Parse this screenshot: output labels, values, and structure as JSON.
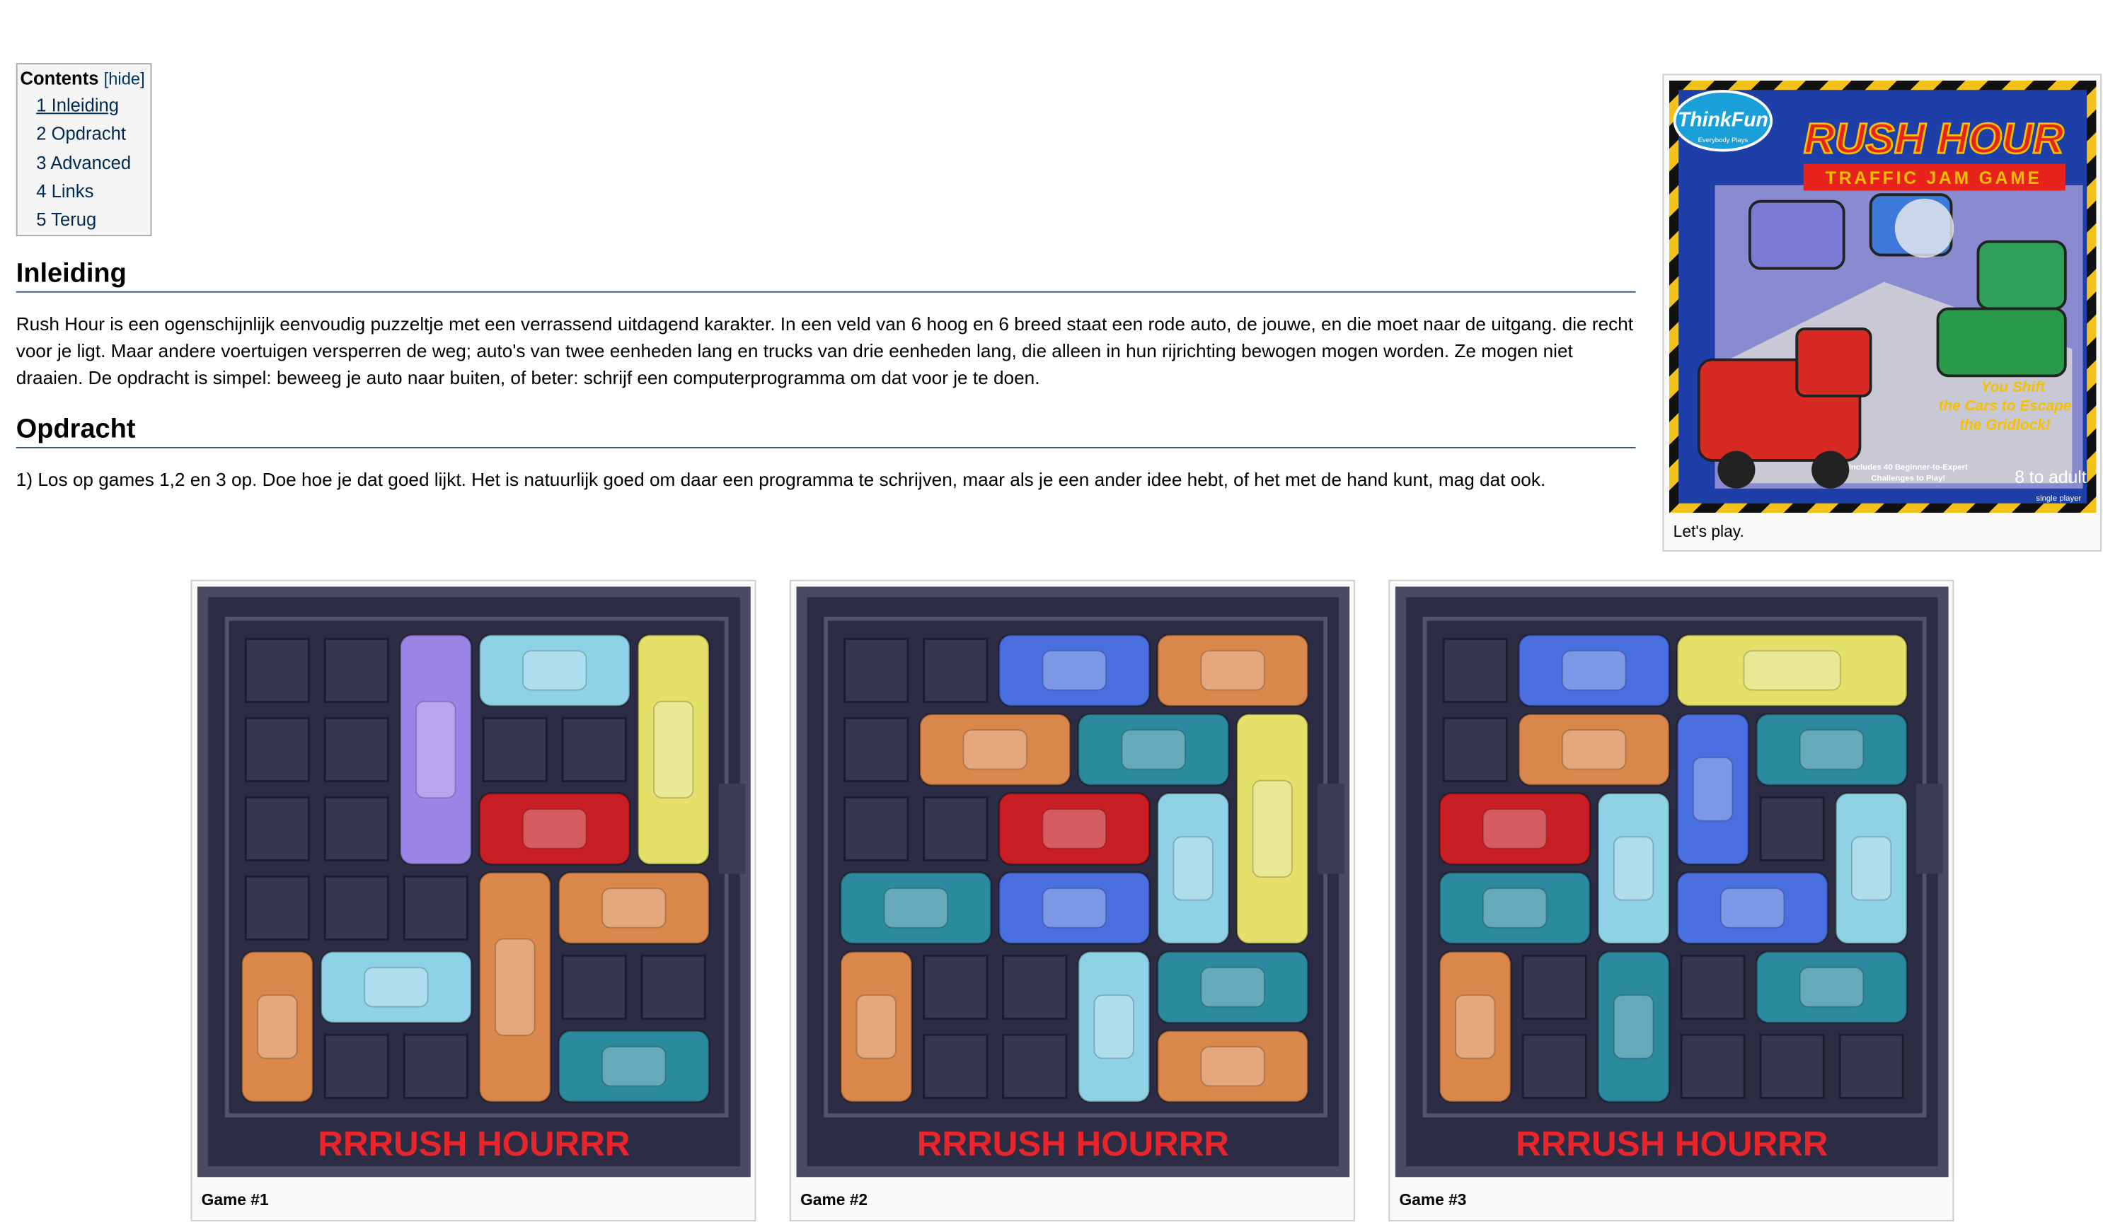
{
  "toc": {
    "title": "Contents",
    "hide": "[hide]",
    "items": [
      "1 Inleiding",
      "2 Opdracht",
      "3 Advanced",
      "4 Links",
      "5 Terug"
    ]
  },
  "sections": {
    "inleiding": {
      "heading": "Inleiding",
      "text": "Rush Hour is een ogenschijnlijk eenvoudig puzzeltje met een verrassend uitdagend karakter. In een veld van 6 hoog en 6 breed staat een rode auto, de jouwe, en die moet naar de uitgang. die recht voor je ligt. Maar andere voertuigen versperren de weg; auto's van twee eenheden lang en trucks van drie eenheden lang, die alleen in hun rijrichting bewogen mogen worden. Ze mogen niet draaien. De opdracht is simpel: beweeg je auto naar buiten, of beter: schrijf een computerprogramma om dat voor je te doen."
    },
    "opdracht": {
      "heading": "Opdracht",
      "text": "1) Los op games 1,2 en 3 op. Doe hoe je dat goed lijkt. Het is natuurlijk goed om daar een programma te schrijven, maar als je een ander idee hebt, of het met de hand kunt, mag dat ook."
    }
  },
  "boxart": {
    "brand": "ThinkFun",
    "brand_tag": "Everybody Plays",
    "title": "RUSH HOUR",
    "subtitle": "TRAFFIC JAM GAME",
    "tagline": [
      "You Shift",
      "the Cars to Escape",
      "the Gridlock!"
    ],
    "note": [
      "Includes 40 Beginner-to-Expert",
      "Challenges to Play!"
    ],
    "age": "8 to adult",
    "players": "single player",
    "caption": "Let's play."
  },
  "colors": {
    "red": "#c81e24",
    "purple": "#9a84e6",
    "lightblue": "#8fd2e6",
    "yellow": "#e4e06a",
    "orange": "#d9874a",
    "teal": "#2c8a9e",
    "blue": "#4a6fe0",
    "board": "#2c2d44",
    "title_red": "#e8252b"
  },
  "games": [
    {
      "caption": "Game #1",
      "board_title": "RRRUSH HOURRR",
      "pieces": [
        {
          "color": "purple",
          "row": 0,
          "col": 2,
          "len": 3,
          "dir": "v"
        },
        {
          "color": "lightblue",
          "row": 0,
          "col": 3,
          "len": 2,
          "dir": "h"
        },
        {
          "color": "yellow",
          "row": 0,
          "col": 5,
          "len": 3,
          "dir": "v"
        },
        {
          "color": "red",
          "row": 2,
          "col": 3,
          "len": 2,
          "dir": "h"
        },
        {
          "color": "orange",
          "row": 3,
          "col": 3,
          "len": 3,
          "dir": "v"
        },
        {
          "color": "orange",
          "row": 3,
          "col": 4,
          "len": 2,
          "dir": "h"
        },
        {
          "color": "orange",
          "row": 4,
          "col": 0,
          "len": 2,
          "dir": "v"
        },
        {
          "color": "lightblue",
          "row": 4,
          "col": 1,
          "len": 2,
          "dir": "h"
        },
        {
          "color": "teal",
          "row": 5,
          "col": 4,
          "len": 2,
          "dir": "h"
        }
      ]
    },
    {
      "caption": "Game #2",
      "board_title": "RRRUSH HOURRR",
      "pieces": [
        {
          "color": "blue",
          "row": 0,
          "col": 2,
          "len": 2,
          "dir": "h"
        },
        {
          "color": "orange",
          "row": 0,
          "col": 4,
          "len": 2,
          "dir": "h"
        },
        {
          "color": "orange",
          "row": 1,
          "col": 1,
          "len": 2,
          "dir": "h"
        },
        {
          "color": "teal",
          "row": 1,
          "col": 3,
          "len": 2,
          "dir": "h"
        },
        {
          "color": "yellow",
          "row": 1,
          "col": 5,
          "len": 3,
          "dir": "v"
        },
        {
          "color": "red",
          "row": 2,
          "col": 2,
          "len": 2,
          "dir": "h"
        },
        {
          "color": "lightblue",
          "row": 2,
          "col": 4,
          "len": 2,
          "dir": "v"
        },
        {
          "color": "teal",
          "row": 3,
          "col": 0,
          "len": 2,
          "dir": "h"
        },
        {
          "color": "blue",
          "row": 3,
          "col": 2,
          "len": 2,
          "dir": "h"
        },
        {
          "color": "orange",
          "row": 4,
          "col": 0,
          "len": 2,
          "dir": "v"
        },
        {
          "color": "lightblue",
          "row": 4,
          "col": 3,
          "len": 2,
          "dir": "v"
        },
        {
          "color": "teal",
          "row": 4,
          "col": 4,
          "len": 2,
          "dir": "h"
        },
        {
          "color": "orange",
          "row": 5,
          "col": 4,
          "len": 2,
          "dir": "h"
        }
      ]
    },
    {
      "caption": "Game #3",
      "board_title": "RRRUSH HOURRR",
      "pieces": [
        {
          "color": "blue",
          "row": 0,
          "col": 1,
          "len": 2,
          "dir": "h"
        },
        {
          "color": "yellow",
          "row": 0,
          "col": 3,
          "len": 3,
          "dir": "h"
        },
        {
          "color": "orange",
          "row": 1,
          "col": 1,
          "len": 2,
          "dir": "h"
        },
        {
          "color": "blue",
          "row": 1,
          "col": 3,
          "len": 2,
          "dir": "v"
        },
        {
          "color": "teal",
          "row": 1,
          "col": 4,
          "len": 2,
          "dir": "h"
        },
        {
          "color": "red",
          "row": 2,
          "col": 0,
          "len": 2,
          "dir": "h"
        },
        {
          "color": "lightblue",
          "row": 2,
          "col": 2,
          "len": 2,
          "dir": "v"
        },
        {
          "color": "lightblue",
          "row": 2,
          "col": 5,
          "len": 2,
          "dir": "v"
        },
        {
          "color": "teal",
          "row": 3,
          "col": 0,
          "len": 2,
          "dir": "h"
        },
        {
          "color": "blue",
          "row": 3,
          "col": 3,
          "len": 2,
          "dir": "h"
        },
        {
          "color": "orange",
          "row": 4,
          "col": 0,
          "len": 2,
          "dir": "v"
        },
        {
          "color": "teal",
          "row": 4,
          "col": 2,
          "len": 2,
          "dir": "v"
        },
        {
          "color": "teal",
          "row": 4,
          "col": 4,
          "len": 2,
          "dir": "h"
        }
      ]
    }
  ]
}
